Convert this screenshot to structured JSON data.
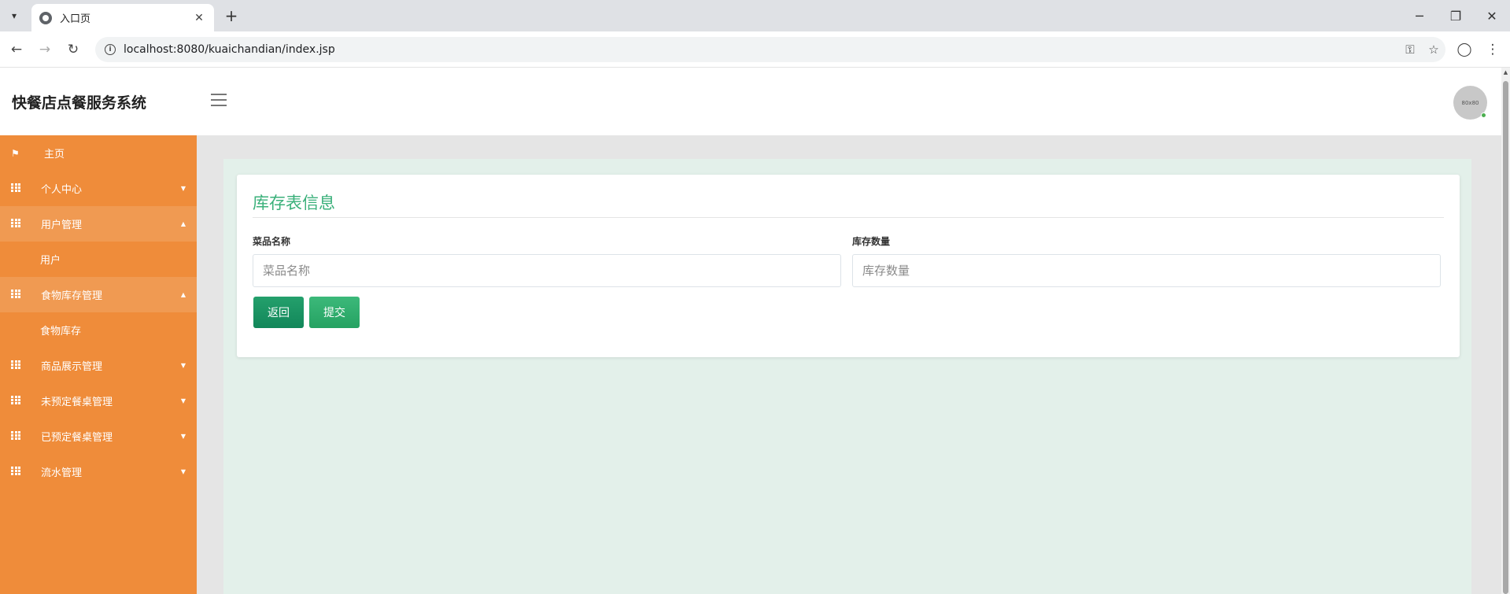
{
  "browser": {
    "tab_title": "入口页",
    "url": "localhost:8080/kuaichandian/index.jsp"
  },
  "header": {
    "brand": "快餐店点餐服务系统",
    "avatar_text": "80x80"
  },
  "sidebar": {
    "home": "主页",
    "personal_center": "个人中心",
    "user_mgmt": "用户管理",
    "user": "用户",
    "food_stock_mgmt": "食物库存管理",
    "food_stock": "食物库存",
    "product_display_mgmt": "商品展示管理",
    "unreserved_table_mgmt": "未预定餐桌管理",
    "reserved_table_mgmt": "已预定餐桌管理",
    "flow_mgmt": "流水管理"
  },
  "form": {
    "title": "库存表信息",
    "dish_name_label": "菜品名称",
    "dish_name_placeholder": "菜品名称",
    "dish_name_value": "",
    "stock_qty_label": "库存数量",
    "stock_qty_placeholder": "库存数量",
    "stock_qty_value": "",
    "back_button": "返回",
    "submit_button": "提交"
  },
  "colors": {
    "sidebar": "#ef8c3a",
    "sidebar_open": "#f09a52",
    "title_green": "#3ab07a",
    "content_bg": "#e3f0ea"
  }
}
